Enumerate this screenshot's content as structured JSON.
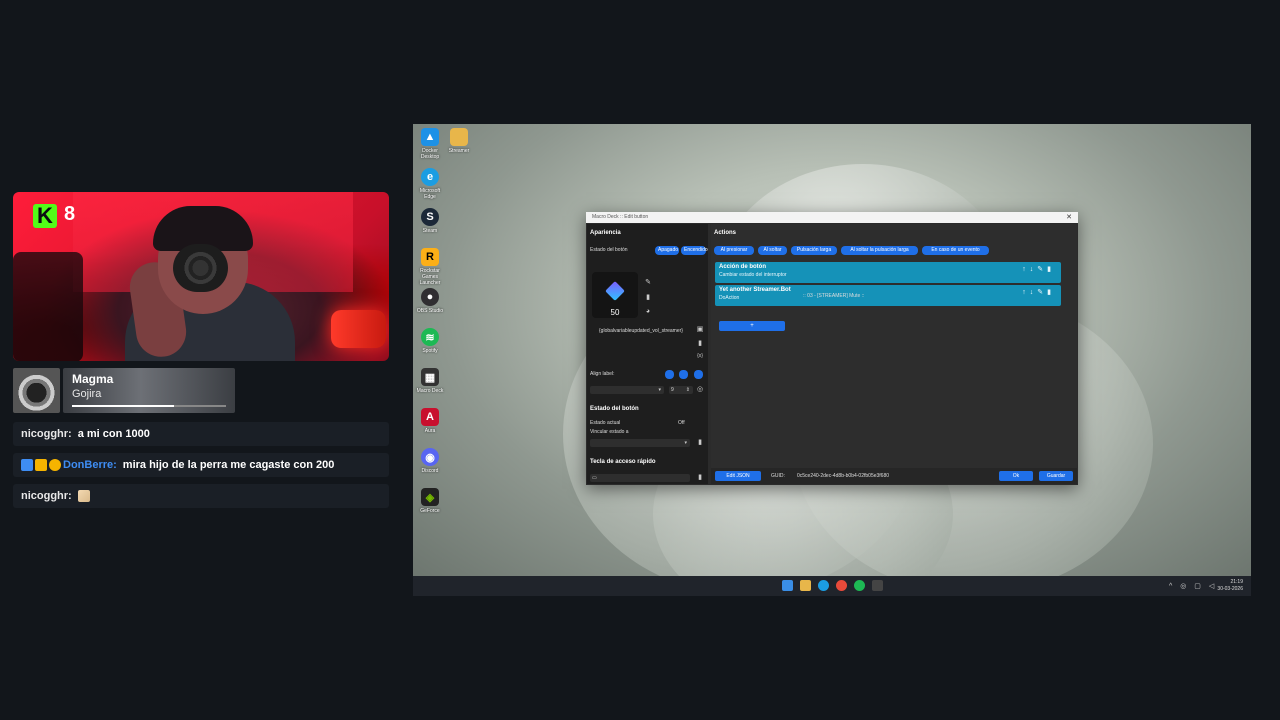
{
  "stream": {
    "viewer_count": "8",
    "now_playing": {
      "title": "Magma",
      "artist": "Gojira",
      "progress": 0.66
    }
  },
  "chat": [
    {
      "user": "nicogghr:",
      "message": "a mi con 1000"
    },
    {
      "user": "DonBerre:",
      "message": "mira hijo de la perra me cagaste con 200"
    },
    {
      "user": "nicogghr:",
      "message": ""
    }
  ],
  "desktop_icons": [
    {
      "label": "Docker Desktop",
      "icon": "docker-icon",
      "color": "#1d91e6"
    },
    {
      "label": "Microsoft Edge",
      "icon": "edge-icon",
      "color": "#1b9de2"
    },
    {
      "label": "Steam",
      "icon": "steam-icon",
      "color": "#1b2838"
    },
    {
      "label": "Rockstar Games Launcher",
      "icon": "rockstar-icon",
      "color": "#fcaf17"
    },
    {
      "label": "OBS Studio",
      "icon": "obs-icon",
      "color": "#302e31"
    },
    {
      "label": "Spotify",
      "icon": "spotify-icon",
      "color": "#1db954"
    },
    {
      "label": "Macro Deck",
      "icon": "macrodeck-icon",
      "color": "#333333"
    },
    {
      "label": "Aura",
      "icon": "aura-icon",
      "color": "#c8102e"
    },
    {
      "label": "Discord",
      "icon": "discord-icon",
      "color": "#5865f2"
    },
    {
      "label": "GeForce",
      "icon": "nvidia-icon",
      "color": "#76b900"
    },
    {
      "label": "Streamer",
      "icon": "folder-icon",
      "color": "#e8b64a"
    }
  ],
  "taskbar": {
    "time": "21:19",
    "date": "30-03-2026"
  },
  "window": {
    "title": "Macro Deck :: Edit button",
    "left": {
      "apariencia": "Apariencia",
      "estado_boton_label": "Estado del botón",
      "apagado": "Apagado",
      "encendido": "Encendido",
      "preview_number": "50",
      "variable_label": "{globalvariableupdated_vol_streamer}",
      "align_label": "Align label:",
      "font_size": "9",
      "estado_title": "Estado del botón",
      "estado_actual": "Estado actual",
      "estado_actual_value": "Off",
      "vincular": "Vincular estado a",
      "tecla_title": "Tecla de acceso rápido"
    },
    "right": {
      "actions_title": "Actions",
      "event_tabs": [
        "Al presionar",
        "Al soltar",
        "Pulsación larga",
        "Al soltar la pulsación larga",
        "En caso de un evento"
      ],
      "actions": [
        {
          "title": "Acción de botón",
          "subtitle": "Cambiar estado del interruptor",
          "detail": ""
        },
        {
          "title": "Yet another Streamer.Bot",
          "subtitle": "DoAction",
          "detail": ":: 03 - [STREAMER] Mute ::"
        }
      ],
      "add_label": "+",
      "edit_json": "Edit JSON",
      "guid_label": "GUID:",
      "guid_value": "0c5ce240-2dec-4d8b-b0b4-02fb05e3f680",
      "ok": "Ok",
      "save": "Guardar"
    }
  }
}
